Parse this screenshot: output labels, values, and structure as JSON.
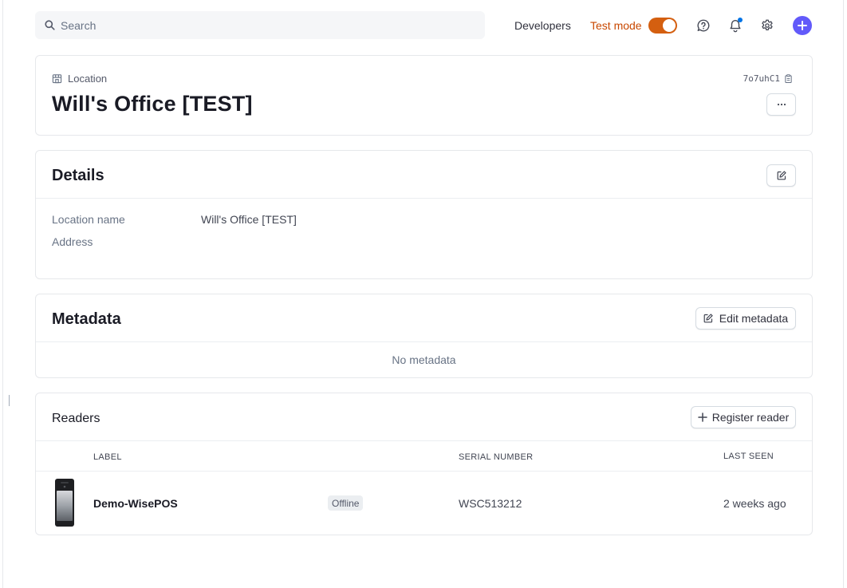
{
  "search": {
    "placeholder": "Search"
  },
  "topbar": {
    "developers_label": "Developers",
    "test_mode_label": "Test mode",
    "test_mode_on": true
  },
  "location": {
    "kicker": "Location",
    "title": "Will's Office [TEST]",
    "id": "7o7uhC1",
    "more_label": "···"
  },
  "details": {
    "title": "Details",
    "rows": [
      {
        "label": "Location name",
        "value": "Will's Office [TEST]"
      },
      {
        "label": "Address",
        "value": ""
      }
    ]
  },
  "metadata": {
    "title": "Metadata",
    "edit_label": "Edit metadata",
    "empty_text": "No metadata"
  },
  "readers": {
    "title": "Readers",
    "register_label": "Register reader",
    "columns": {
      "label": "LABEL",
      "serial": "SERIAL NUMBER",
      "last_seen": "LAST SEEN"
    },
    "rows": [
      {
        "label": "Demo-WisePOS",
        "status": "Offline",
        "serial": "WSC513212",
        "last_seen": "2 weeks ago"
      }
    ]
  },
  "colors": {
    "accent": "#625afa",
    "test_mode": "#d45f10",
    "text_primary": "#1a1b25",
    "text_secondary": "#687385"
  }
}
